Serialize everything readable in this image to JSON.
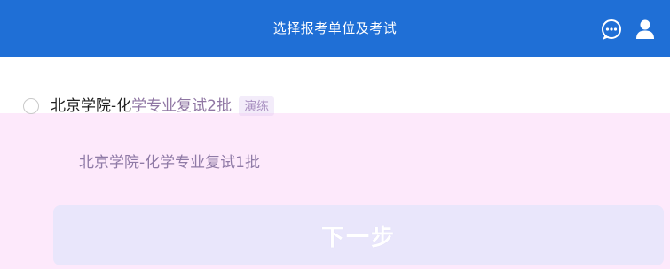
{
  "header": {
    "title": "选择报考单位及考试",
    "icons": [
      "chat-icon",
      "user-icon"
    ],
    "background": "#1f6fd6"
  },
  "options": [
    {
      "label_prefix": "北京学院-化",
      "label_rest": "学专业复试2批",
      "tag": "演练",
      "selected": false
    }
  ],
  "sub_option": {
    "label": "北京学院-化学专业复试1批"
  },
  "next_button": {
    "label": "下一步"
  },
  "colors": {
    "overlay": "#fde8fb",
    "button": "#e9e6fb"
  }
}
